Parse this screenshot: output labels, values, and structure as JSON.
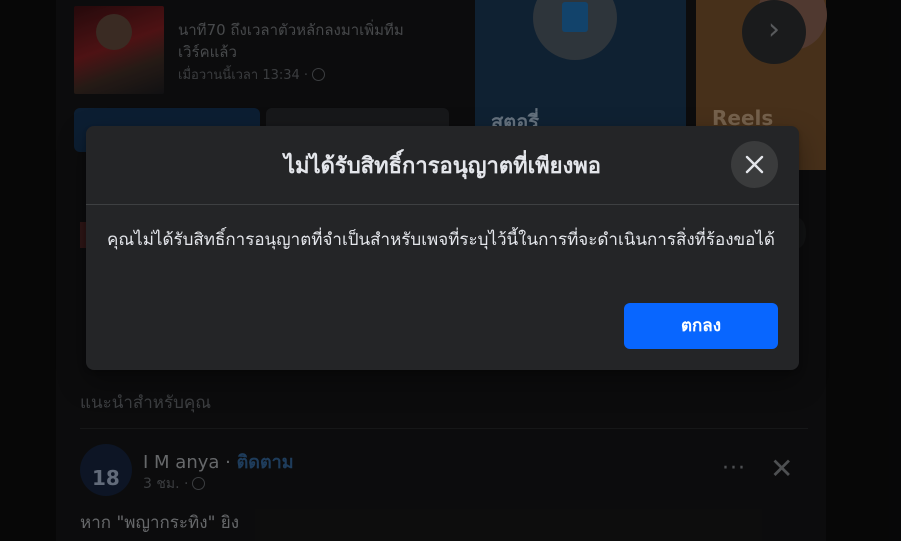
{
  "background": {
    "news_post": {
      "line1": "นาที70 ถึงเวลาตัวหลักลงมาเพิ่มทีม",
      "line2": "เวิร์คแล้ว",
      "time": "เมื่อวานนี้เวลา 13:34 ·"
    },
    "story_card_label": "สตอรี่",
    "reels_card_label": "Reels",
    "next_arrow": "›",
    "suggested_label": "แนะนำสำหรับคุณ",
    "post": {
      "avatar_number": "18",
      "author": "I M anya",
      "separator": " · ",
      "follow_label": "ติดตาม",
      "time": "3 ชม. ·",
      "more_icon": "···",
      "close_icon": "✕",
      "text": "หาก \"พญากระทิง\" ยิง"
    }
  },
  "dialog": {
    "title": "ไม่ได้รับสิทธิ์การอนุญาตที่เพียงพอ",
    "message": "คุณไม่ได้รับสิทธิ์การอนุญาตที่จำเป็นสำหรับเพจที่ระบุไว้นี้ในการที่จะดำเนินการสิ่งที่ร้องขอได้",
    "ok_label": "ตกลง",
    "close_icon": "close-icon"
  },
  "colors": {
    "primary_button": "#0866ff",
    "dialog_bg": "#242527",
    "close_button_bg": "#3a3b3c"
  }
}
